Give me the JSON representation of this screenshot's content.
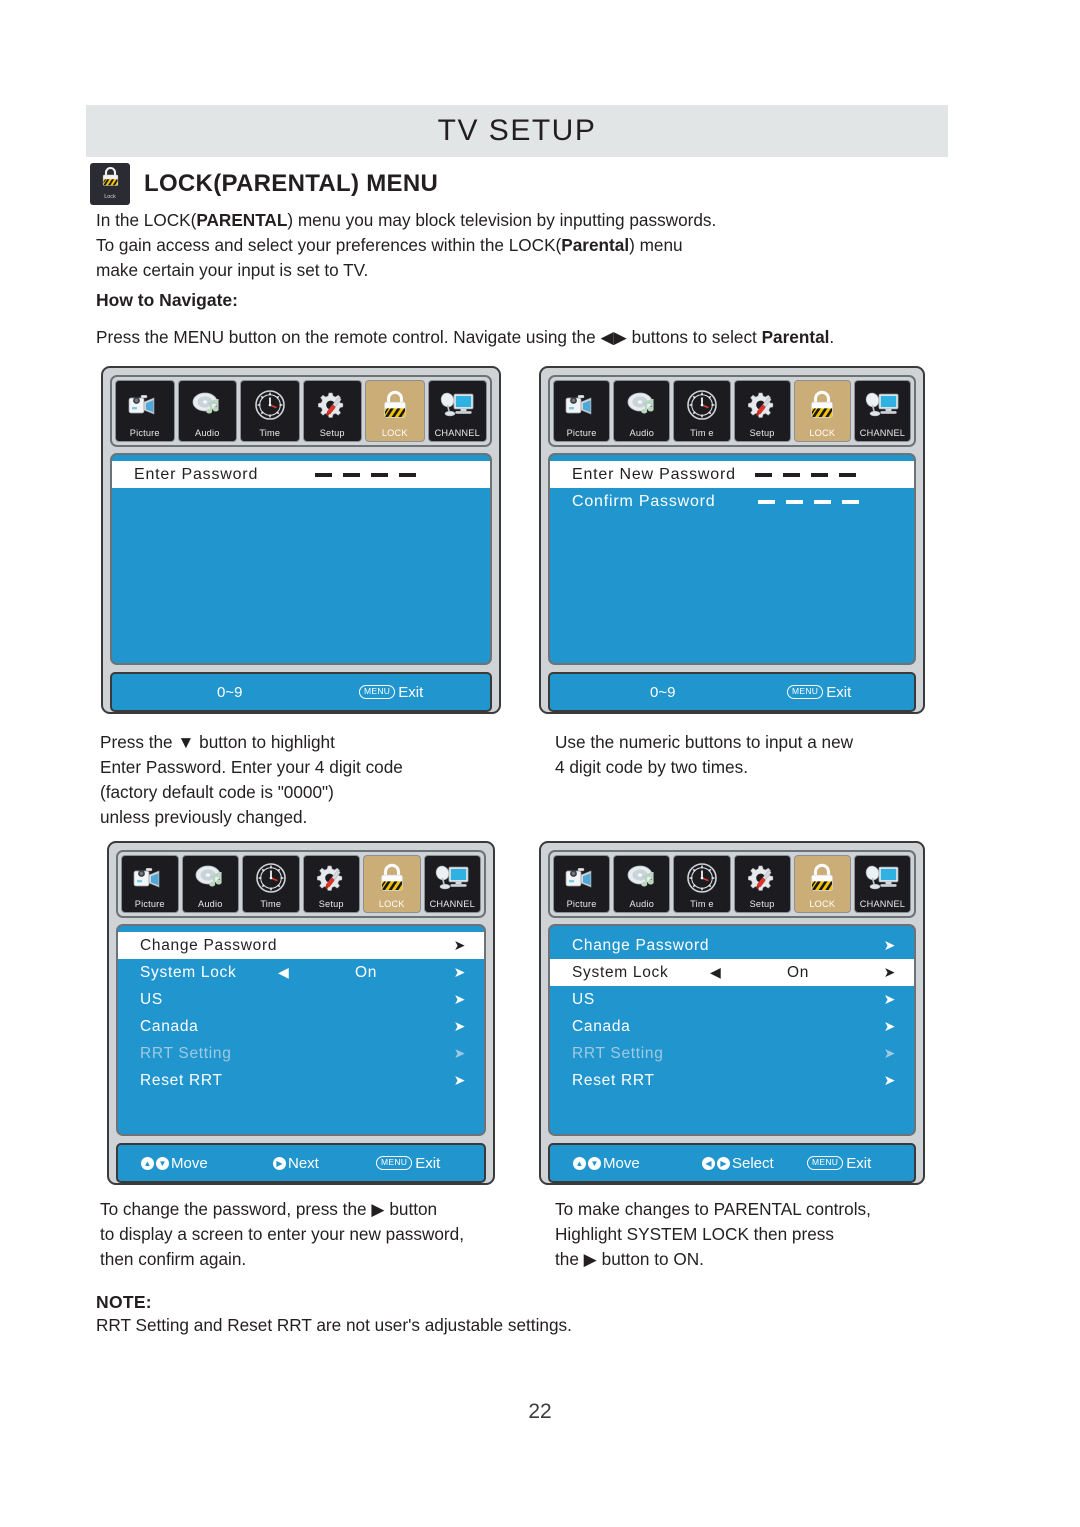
{
  "header": {
    "title": "TV SETUP",
    "section_title": "LOCK(PARENTAL) MENU",
    "section_icon_label": "Lock"
  },
  "intro": {
    "line1_a": "In the LOCK(",
    "line1_b": "PARENTAL",
    "line1_c": ") menu you may block television by inputting passwords.",
    "line2_a": "To gain access and select your preferences within the LOCK(",
    "line2_b": "Parental",
    "line2_c": ") menu",
    "line3": "make certain your input is set to TV."
  },
  "navigate": {
    "label": "How to Navigate:",
    "text_a": "Press the MENU button on the remote control. Navigate using the ",
    "arrows": "◀▶",
    "text_b": " buttons to select ",
    "bold": "Parental",
    "text_c": "."
  },
  "osd_tabs": [
    {
      "label": "Picture",
      "icon": "camcorder-icon",
      "active": false
    },
    {
      "label": "Audio",
      "icon": "cd-music-note-icon",
      "active": false
    },
    {
      "label": "Time",
      "icon": "clock-icon",
      "active": false
    },
    {
      "label": "Setup",
      "icon": "gear-screwdriver-icon",
      "active": false
    },
    {
      "label": "LOCK",
      "icon": "padlock-icon",
      "active": true
    },
    {
      "label": "CHANNEL",
      "icon": "satellite-monitor-icon",
      "active": false
    }
  ],
  "osd_tabs_alt": [
    {
      "label": "Picture",
      "icon": "camcorder-icon",
      "active": false
    },
    {
      "label": "Audio",
      "icon": "cd-music-note-icon",
      "active": false
    },
    {
      "label": "Tim e",
      "icon": "clock-icon",
      "active": false
    },
    {
      "label": "Setup",
      "icon": "gear-screwdriver-icon",
      "active": false
    },
    {
      "label": "LOCK",
      "icon": "padlock-icon",
      "active": true
    },
    {
      "label": "CHANNEL",
      "icon": "satellite-monitor-icon",
      "active": false
    }
  ],
  "panel1": {
    "rows": [
      {
        "label": "Enter Password",
        "highlighted": true,
        "dashes": 4
      }
    ],
    "footer": {
      "left": "0~9",
      "menu_key": "MENU",
      "exit": "Exit"
    },
    "caption": "Press the ▼ button to highlight\nEnter Password. Enter your 4 digit code\n(factory default code is \"0000\")\nunless previously changed."
  },
  "panel2": {
    "rows": [
      {
        "label": "Enter New Password",
        "highlighted": true,
        "dashes": 4
      },
      {
        "label": "Confirm Password",
        "highlighted": false,
        "dashes": 4
      }
    ],
    "footer": {
      "left": "0~9",
      "menu_key": "MENU",
      "exit": "Exit"
    },
    "caption": "Use the numeric buttons to input a new\n4 digit code by two times."
  },
  "panel3": {
    "rows": [
      {
        "label": "Change Password",
        "highlighted": true,
        "dim": false,
        "value": "",
        "left_arrow": false,
        "right_arrow": "➤"
      },
      {
        "label": "System Lock",
        "highlighted": false,
        "dim": false,
        "value": "On",
        "left_arrow": true,
        "right_arrow": "➤"
      },
      {
        "label": "US",
        "highlighted": false,
        "dim": false,
        "value": "",
        "left_arrow": false,
        "right_arrow": "➤"
      },
      {
        "label": "Canada",
        "highlighted": false,
        "dim": false,
        "value": "",
        "left_arrow": false,
        "right_arrow": "➤"
      },
      {
        "label": "RRT Setting",
        "highlighted": false,
        "dim": true,
        "value": "",
        "left_arrow": false,
        "right_arrow": "➤"
      },
      {
        "label": "Reset RRT",
        "highlighted": false,
        "dim": false,
        "value": "",
        "left_arrow": false,
        "right_arrow": "➤"
      }
    ],
    "footer": {
      "move": "Move",
      "middle": "Next",
      "middle_keys": "single",
      "menu_key": "MENU",
      "exit": "Exit"
    },
    "caption": "To change the password, press the ▶ button\nto display a screen to enter your new password,\nthen confirm again."
  },
  "panel4": {
    "rows": [
      {
        "label": "Change Password",
        "highlighted": false,
        "dim": false,
        "value": "",
        "left_arrow": false,
        "right_arrow": "➤"
      },
      {
        "label": "System Lock",
        "highlighted": true,
        "dim": false,
        "value": "On",
        "left_arrow": true,
        "right_arrow": "➤"
      },
      {
        "label": "US",
        "highlighted": false,
        "dim": false,
        "value": "",
        "left_arrow": false,
        "right_arrow": "➤"
      },
      {
        "label": "Canada",
        "highlighted": false,
        "dim": false,
        "value": "",
        "left_arrow": false,
        "right_arrow": "➤"
      },
      {
        "label": "RRT Setting",
        "highlighted": false,
        "dim": true,
        "value": "",
        "left_arrow": false,
        "right_arrow": "➤"
      },
      {
        "label": "Reset RRT",
        "highlighted": false,
        "dim": false,
        "value": "",
        "left_arrow": false,
        "right_arrow": "➤"
      }
    ],
    "footer": {
      "move": "Move",
      "middle": "Select",
      "middle_keys": "double",
      "menu_key": "MENU",
      "exit": "Exit"
    },
    "caption": "To make changes to PARENTAL controls,\nHighlight SYSTEM LOCK then press\nthe ▶ button to ON."
  },
  "note": {
    "label": "NOTE:",
    "text": "RRT Setting and Reset RRT are not user's adjustable settings."
  },
  "page_number": "22",
  "colors": {
    "osd_blue": "#2196ce",
    "lock_tan": "#cbad77",
    "title_bar": "#e2e5e6",
    "tab_dark": "#1c1c20",
    "dim_text": "#9fc9e2"
  }
}
